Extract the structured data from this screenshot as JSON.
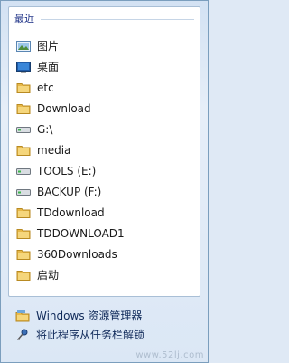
{
  "recent": {
    "header": "最近",
    "items": [
      {
        "label": "图片",
        "icon": "pictures-icon"
      },
      {
        "label": "桌面",
        "icon": "desktop-icon"
      },
      {
        "label": "etc",
        "icon": "folder-icon"
      },
      {
        "label": "Download",
        "icon": "folder-icon"
      },
      {
        "label": "G:\\",
        "icon": "drive-icon"
      },
      {
        "label": "media",
        "icon": "folder-icon"
      },
      {
        "label": "TOOLS (E:)",
        "icon": "drive-icon"
      },
      {
        "label": "BACKUP (F:)",
        "icon": "drive-icon"
      },
      {
        "label": "TDdownload",
        "icon": "folder-icon"
      },
      {
        "label": "TDDOWNLOAD1",
        "icon": "folder-icon"
      },
      {
        "label": "360Downloads",
        "icon": "folder-icon"
      },
      {
        "label": "启动",
        "icon": "folder-icon"
      }
    ]
  },
  "tasks": [
    {
      "label": "Windows 资源管理器",
      "icon": "explorer-icon"
    },
    {
      "label": "将此程序从任务栏解锁",
      "icon": "unpin-icon"
    }
  ],
  "watermark": "www.52lj.com",
  "colors": {
    "header": "#1e3287",
    "folder": "#e8b94a",
    "panel_border": "#7b9ebd"
  }
}
